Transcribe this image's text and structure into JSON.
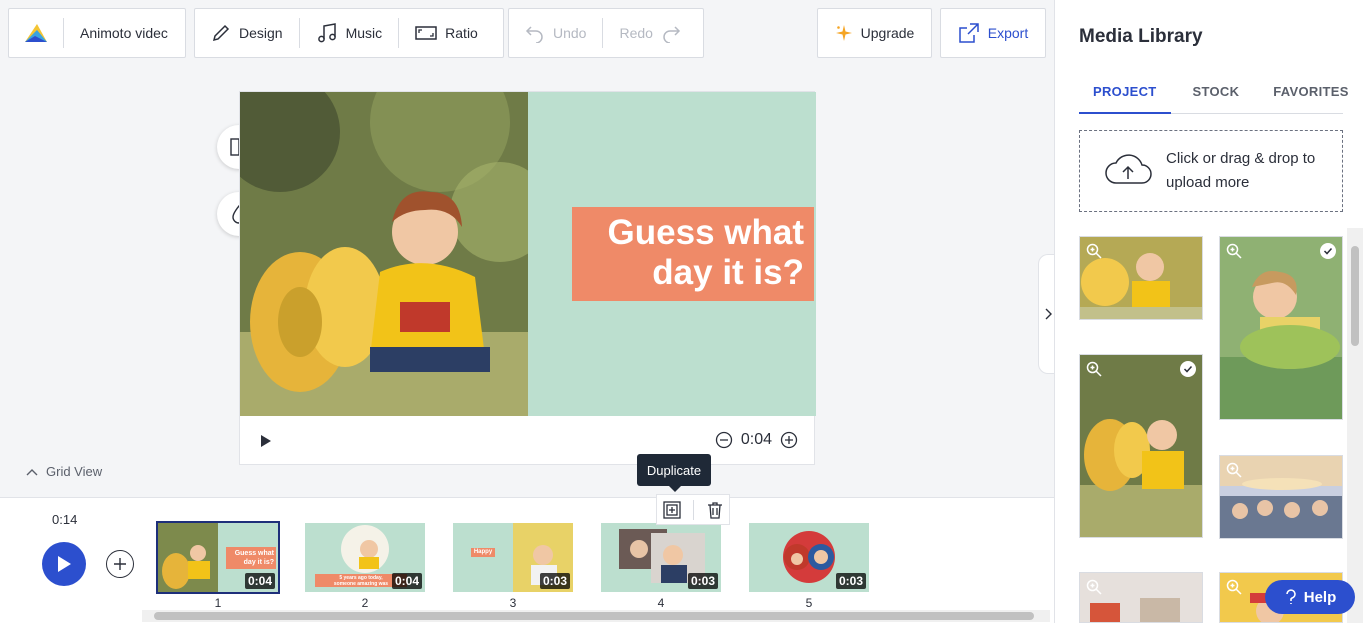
{
  "toolbar": {
    "project_title": "Animoto videc",
    "design_label": "Design",
    "music_label": "Music",
    "ratio_label": "Ratio",
    "undo_label": "Undo",
    "redo_label": "Redo",
    "upgrade_label": "Upgrade",
    "export_label": "Export"
  },
  "preview": {
    "caption": "Guess what\nday it is?",
    "duration": "0:04"
  },
  "grid_view_label": "Grid View",
  "tooltip": "Duplicate",
  "timeline": {
    "total_time": "0:14",
    "scenes": [
      {
        "number": "1",
        "duration": "0:04",
        "selected": true
      },
      {
        "number": "2",
        "duration": "0:04"
      },
      {
        "number": "3",
        "duration": "0:03"
      },
      {
        "number": "4",
        "duration": "0:03"
      },
      {
        "number": "5",
        "duration": "0:03"
      }
    ],
    "thumb_texts": {
      "scene1": "Guess what\nday it is?",
      "scene2": "5 years ago today,\nsomeone amazing was",
      "scene3": "Happy"
    }
  },
  "sidebar": {
    "title": "Media Library",
    "tabs": [
      "PROJECT",
      "STOCK",
      "FAVORITES"
    ],
    "active_tab": "PROJECT",
    "upload_text": "Click or drag & drop to upload more"
  },
  "help_label": "Help",
  "colors": {
    "accent": "#2c4fce",
    "caption_bg": "#ef8a68",
    "scene_bg": "#bcdfcf"
  }
}
